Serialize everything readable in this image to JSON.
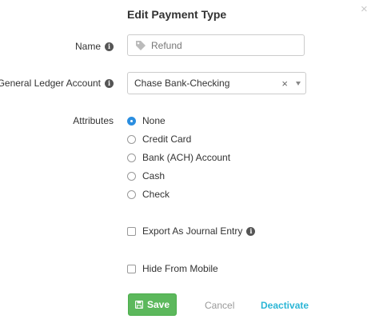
{
  "dialog": {
    "title": "Edit Payment Type",
    "close_icon": "close-icon"
  },
  "form": {
    "name_label": "Name",
    "name_placeholder": "Refund",
    "gl_label": "General Ledger Account",
    "gl_value": "Chase Bank-Checking",
    "attributes_label": "Attributes",
    "attributes": [
      {
        "label": "None",
        "checked": true
      },
      {
        "label": "Credit Card",
        "checked": false
      },
      {
        "label": "Bank (ACH) Account",
        "checked": false
      },
      {
        "label": "Cash",
        "checked": false
      },
      {
        "label": "Check",
        "checked": false
      }
    ],
    "export_label": "Export As Journal Entry",
    "export_checked": false,
    "hide_label": "Hide From Mobile",
    "hide_checked": false
  },
  "actions": {
    "save_label": "Save",
    "cancel_label": "Cancel",
    "deactivate_label": "Deactivate"
  },
  "colors": {
    "accent": "#2b8ee0",
    "save_green": "#5cb85c",
    "deactivate_link": "#2bb6d6"
  }
}
